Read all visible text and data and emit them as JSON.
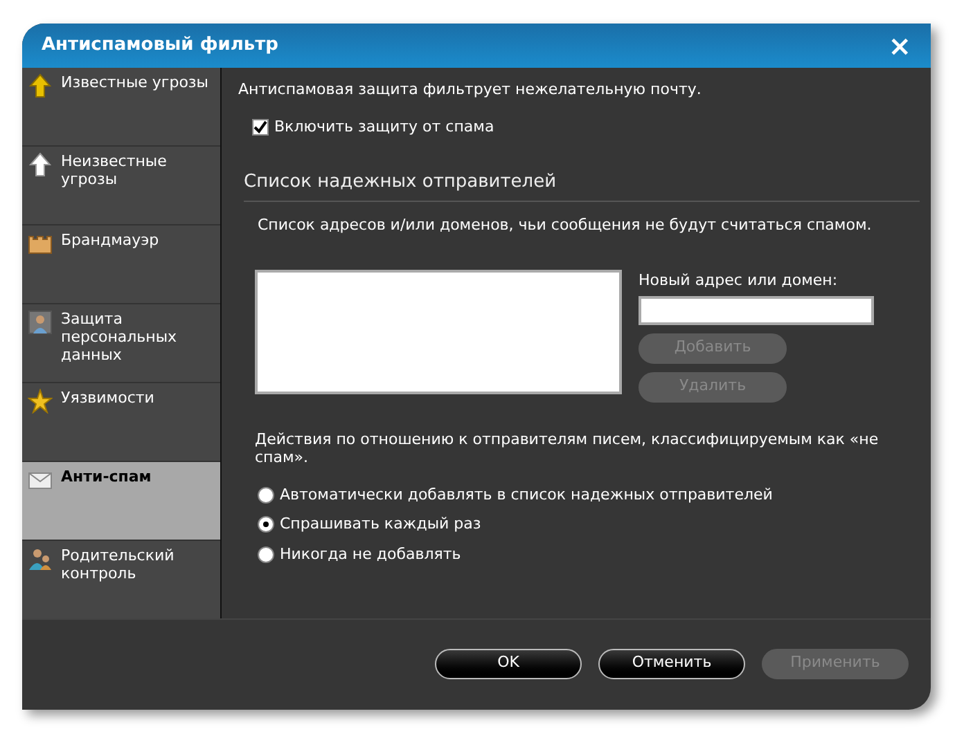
{
  "window": {
    "title": "Антиспамовый фильтр",
    "close": "×"
  },
  "sidebar": {
    "items": [
      {
        "label": "Известные угрозы",
        "selected": false
      },
      {
        "label": "Неизвестные угрозы",
        "selected": false
      },
      {
        "label": "Брандмауэр",
        "selected": false
      },
      {
        "label": "Защита персональных данных",
        "selected": false
      },
      {
        "label": "Уязвимости",
        "selected": false
      },
      {
        "label": "Анти-спам",
        "selected": true
      },
      {
        "label": "Родительский контроль",
        "selected": false
      }
    ]
  },
  "intro": "Антиспамовая защита фильтрует нежелательную почту.",
  "enable": {
    "label": "Включить защиту от спама",
    "checked": true
  },
  "trusted": {
    "heading": "Список надежных отправителей",
    "description": "Список адресов и/или доменов, чьи сообщения не будут считаться спамом.",
    "new_label": "Новый адрес или домен:",
    "buttons": [
      {
        "label": "Добавить",
        "disabled": true
      },
      {
        "label": "Удалить",
        "disabled": true
      }
    ]
  },
  "actions": {
    "description": "Действия по отношению к отправителям писем, классифицируемым как «не спам».",
    "options": [
      {
        "label": "Автоматически добавлять в список надежных отправителей",
        "selected": false
      },
      {
        "label": "Спрашивать каждый раз",
        "selected": true
      },
      {
        "label": "Никогда не добавлять",
        "selected": false
      }
    ]
  },
  "footer": {
    "buttons": [
      {
        "label": "OK",
        "disabled": false
      },
      {
        "label": "Отменить",
        "disabled": false
      },
      {
        "label": "Применить",
        "disabled": true
      }
    ]
  }
}
